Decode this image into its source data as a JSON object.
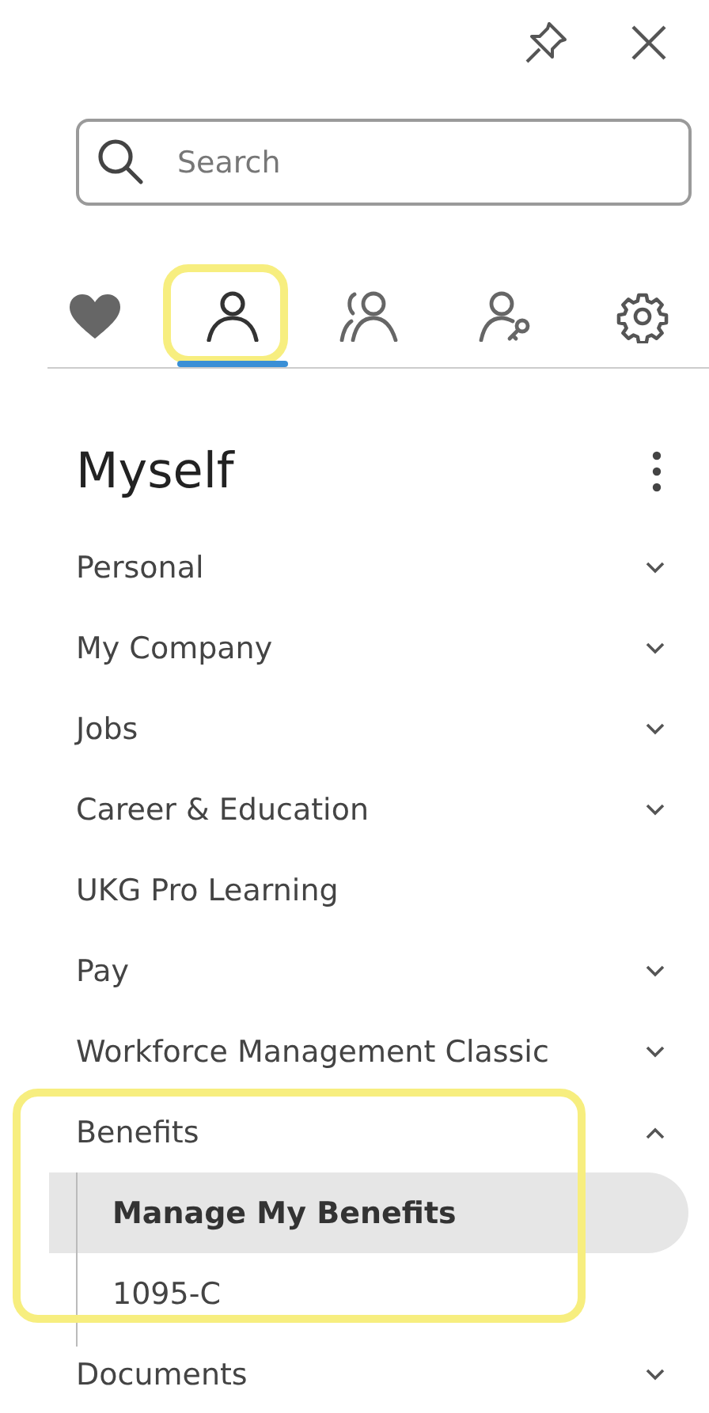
{
  "search": {
    "placeholder": "Search"
  },
  "tabs": [
    {
      "selected": false,
      "highlighted": false
    },
    {
      "selected": true,
      "highlighted": true
    },
    {
      "selected": false,
      "highlighted": false
    },
    {
      "selected": false,
      "highlighted": false
    },
    {
      "selected": false,
      "highlighted": false
    }
  ],
  "section": {
    "title": "Myself"
  },
  "menu": [
    {
      "label": "Personal",
      "expandable": true,
      "expanded": false,
      "highlighted": false
    },
    {
      "label": "My Company",
      "expandable": true,
      "expanded": false,
      "highlighted": false
    },
    {
      "label": "Jobs",
      "expandable": true,
      "expanded": false,
      "highlighted": false
    },
    {
      "label": "Career & Education",
      "expandable": true,
      "expanded": false,
      "highlighted": false
    },
    {
      "label": "UKG Pro Learning",
      "expandable": false,
      "expanded": false,
      "highlighted": false
    },
    {
      "label": "Pay",
      "expandable": true,
      "expanded": false,
      "highlighted": false
    },
    {
      "label": "Workforce Management Classic",
      "expandable": true,
      "expanded": false,
      "highlighted": false
    },
    {
      "label": "Benefits",
      "expandable": true,
      "expanded": true,
      "highlighted": true,
      "children": [
        {
          "label": "Manage My Benefits",
          "selected": true
        },
        {
          "label": "1095-C",
          "selected": false
        }
      ]
    },
    {
      "label": "Documents",
      "expandable": true,
      "expanded": false,
      "highlighted": false
    }
  ]
}
